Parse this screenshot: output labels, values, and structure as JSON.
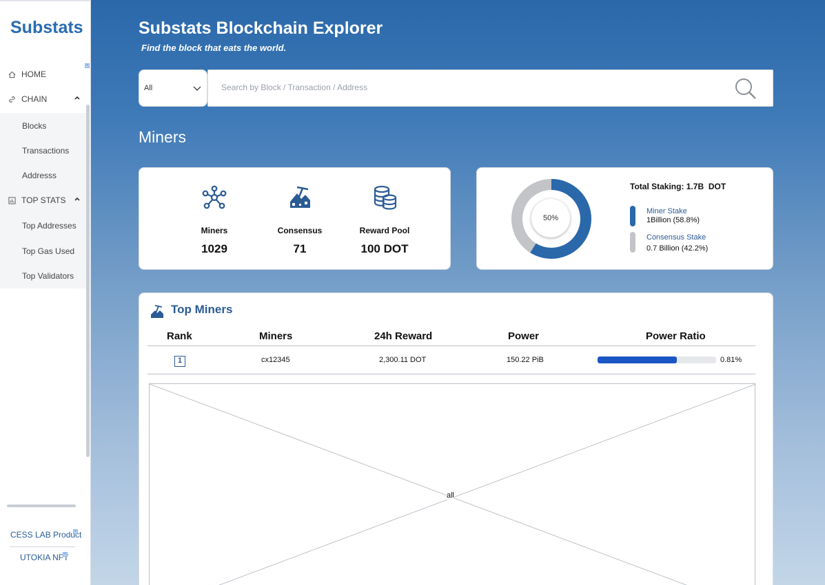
{
  "sidebar": {
    "brand": "Substats",
    "nav": {
      "home": {
        "label": "HOME",
        "icon": "home-icon"
      },
      "chain": {
        "label": "CHAIN",
        "icon": "link-icon",
        "items": [
          "Blocks",
          "Transactions",
          "Addresss"
        ]
      },
      "top_stats": {
        "label": "TOP STATS",
        "icon": "bar-chart-icon",
        "items": [
          "Top Addresses",
          "Top Gas Used",
          "Top Validators"
        ]
      }
    },
    "footer": {
      "cess": "CESS LAB Product",
      "utokia": "UTOKIA NFT"
    }
  },
  "header": {
    "title": "Substats Blockchain Explorer",
    "tagline": "Find the block that eats the world."
  },
  "search": {
    "filter": "All",
    "placeholder": "Search by Block / Transaction / Address"
  },
  "section_title": "Miners",
  "stats": {
    "miners": {
      "label": "Miners",
      "value": "1029",
      "icon": "network-icon"
    },
    "consensus": {
      "label": "Consensus",
      "value": "71",
      "icon": "mining-icon"
    },
    "reward_pool": {
      "label": "Reward Pool",
      "value": "100 DOT",
      "icon": "coins-icon"
    }
  },
  "staking": {
    "total_label": "Total Staking:",
    "total_value": "1.7B  DOT",
    "center_label": "50%",
    "miner": {
      "name": "Miner Stake",
      "value": "1Billion (58.8%)",
      "fraction": 0.588,
      "color": "#2a68aa"
    },
    "consensus": {
      "name": "Consensus Stake",
      "value": "0.7 Billion (42.2%)",
      "fraction": 0.412,
      "color": "#c2c4c7"
    }
  },
  "top_miners": {
    "title": "Top Miners",
    "headers": {
      "rank": "Rank",
      "miners": "Miners",
      "reward": "24h Reward",
      "power": "Power",
      "ratio": "Power Ratio"
    },
    "rows": [
      {
        "rank": "1",
        "miner": "cx12345",
        "reward": "2,300.11  DOT",
        "power": "150.22 PiB",
        "ratio": "0.81%",
        "ratio_bar": 0.67
      }
    ],
    "placeholder_label": "all"
  }
}
